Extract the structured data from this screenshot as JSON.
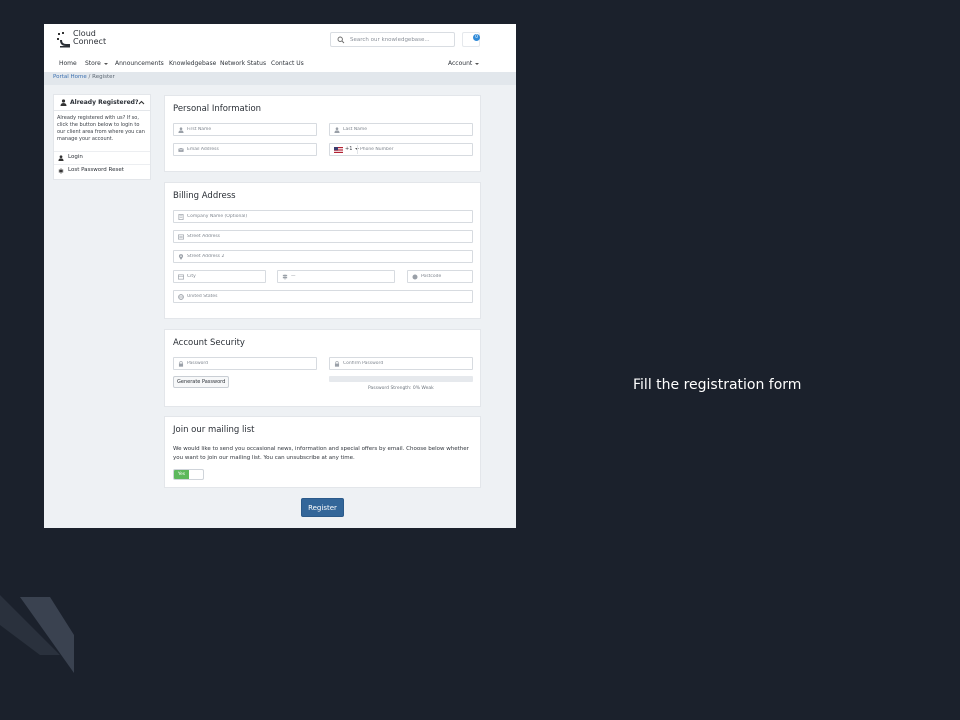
{
  "caption": "Fill the registration form",
  "brand": {
    "line1": "Cloud",
    "line2": "Connect"
  },
  "search": {
    "placeholder": "Search our knowledgebase..."
  },
  "cart": {
    "count": "0"
  },
  "nav": {
    "home": "Home",
    "store": "Store",
    "announcements": "Announcements",
    "knowledgebase": "Knowledgebase",
    "network_status": "Network Status",
    "contact_us": "Contact Us",
    "account": "Account"
  },
  "breadcrumb": {
    "home": "Portal Home",
    "separator": "/",
    "current": "Register"
  },
  "sidebar": {
    "title": "Already Registered?",
    "text": "Already registered with us? If so, click the button below to login to our client area from where you can manage your account.",
    "links": [
      {
        "label": "Login",
        "icon": "user-icon"
      },
      {
        "label": "Lost Password Reset",
        "icon": "asterisk-icon"
      }
    ]
  },
  "personal": {
    "title": "Personal Information",
    "first_name": "First Name",
    "last_name": "Last Name",
    "email": "Email Address",
    "dial_code": "+1",
    "phone": "Phone Number"
  },
  "billing": {
    "title": "Billing Address",
    "company": "Company Name (Optional)",
    "street": "Street Address",
    "street2": "Street Address 2",
    "city": "City",
    "state": "—",
    "postcode": "Postcode",
    "country": "United States"
  },
  "security": {
    "title": "Account Security",
    "password": "Password",
    "confirm": "Confirm Password",
    "generate": "Generate Password",
    "strength_text": "Password Strength: 0% Weak",
    "strength_percent": 0
  },
  "mailing": {
    "title": "Join our mailing list",
    "text": "We would like to send you occasional news, information and special offers by email. Choose below whether you want to join our mailing list. You can unsubscribe at any time.",
    "toggle_label": "Yes"
  },
  "register": {
    "label": "Register"
  },
  "colors": {
    "accent": "#336699",
    "toggle_on": "#5cb85c",
    "background": "#1b212c"
  }
}
